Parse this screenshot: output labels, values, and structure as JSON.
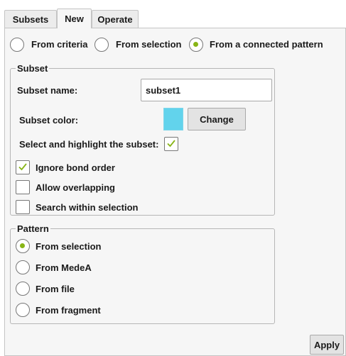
{
  "tabs": [
    {
      "label": "Subsets",
      "active": false
    },
    {
      "label": "New",
      "active": true
    },
    {
      "label": "Operate",
      "active": false
    }
  ],
  "source_options": [
    {
      "label": "From criteria",
      "selected": false
    },
    {
      "label": "From selection",
      "selected": false
    },
    {
      "label": "From a connected pattern",
      "selected": true
    }
  ],
  "subset_group": {
    "title": "Subset",
    "name_label": "Subset name:",
    "name_value": "subset1",
    "color_label": "Subset color:",
    "color_value": "#62d3ec",
    "change_button": "Change",
    "highlight_label": "Select and highlight the subset:",
    "highlight_checked": true,
    "options": [
      {
        "label": "Ignore bond order",
        "checked": true
      },
      {
        "label": "Allow overlapping",
        "checked": false
      },
      {
        "label": "Search within selection",
        "checked": false
      }
    ]
  },
  "pattern_group": {
    "title": "Pattern",
    "options": [
      {
        "label": "From selection",
        "selected": true
      },
      {
        "label": "From MedeA",
        "selected": false
      },
      {
        "label": "From file",
        "selected": false
      },
      {
        "label": "From fragment",
        "selected": false
      }
    ]
  },
  "apply_button": "Apply",
  "colors": {
    "accent": "#88b516",
    "panel": "#f6f6f6",
    "border": "#c4c4c4"
  }
}
